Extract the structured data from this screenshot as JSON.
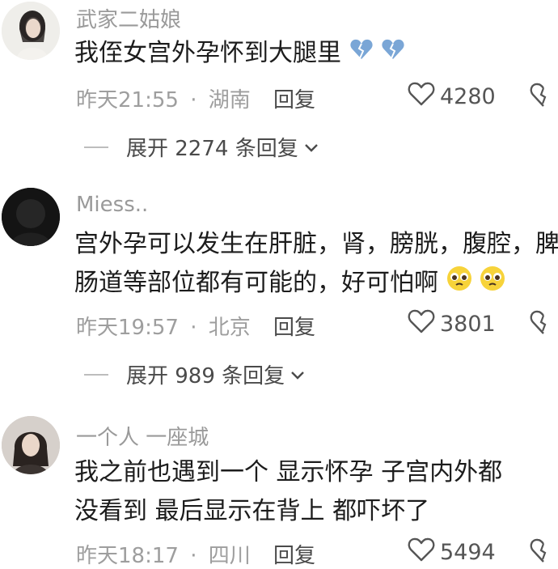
{
  "comments": [
    {
      "username": "武家二姑娘",
      "text_lines": [
        "我侄女宫外孕怀到大腿里"
      ],
      "time": "昨天21:55",
      "separator": "·",
      "location": "湖南",
      "reply_label": "回复",
      "likes": "4280",
      "expand_label": "展开 2274 条回复",
      "trailing_emoji": "broken-heart-icon"
    },
    {
      "username": "Miess..",
      "text_lines": [
        "宫外孕可以发生在肝脏，肾，膀胱，腹腔，脾，",
        "肠道等部位都有可能的，好可怕啊"
      ],
      "time": "昨天19:57",
      "separator": "·",
      "location": "北京",
      "reply_label": "回复",
      "likes": "3801",
      "expand_label": "展开 989 条回复",
      "trailing_emoji": "pleading-face-icon"
    },
    {
      "username": "一个人 一座城",
      "text_lines": [
        "我之前也遇到一个  显示怀孕  子宫内外都",
        "没看到  最后显示在背上  都吓坏了"
      ],
      "time": "昨天18:17",
      "separator": "·",
      "location": "四川",
      "reply_label": "回复",
      "likes": "5494"
    }
  ],
  "colors": {
    "meta": "#9e9e9e",
    "username": "#9a9a9a",
    "text": "#1c1c1c",
    "emoji_heart": "#7aa6d6",
    "emoji_face": "#f7d33a"
  }
}
